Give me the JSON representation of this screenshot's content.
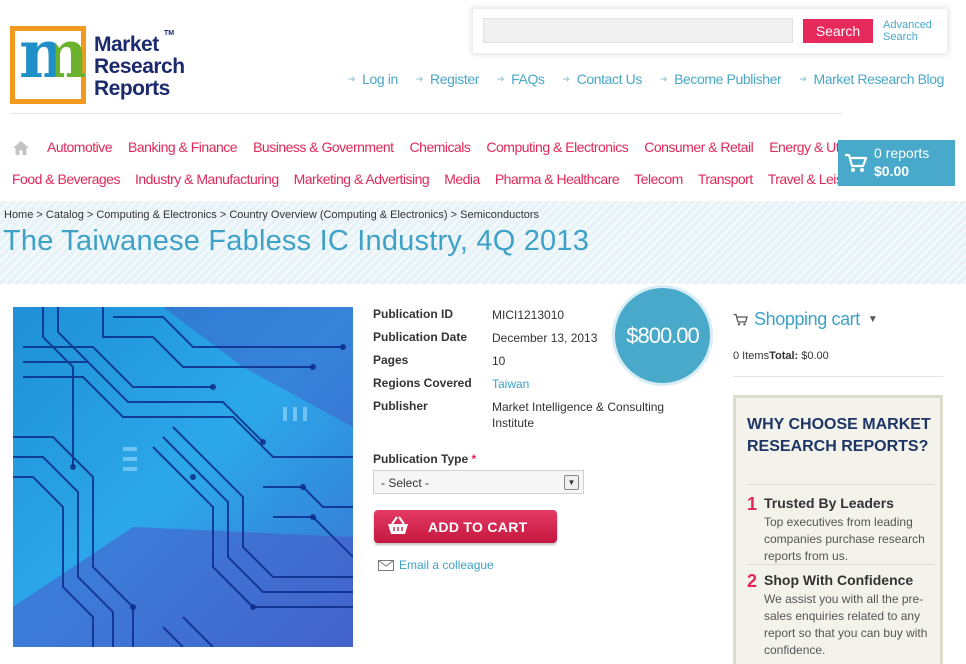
{
  "logo": {
    "letter_m": "m",
    "line1": "Market",
    "line2": "Research",
    "line3": "Reports",
    "tm": "TM"
  },
  "search": {
    "placeholder": "",
    "button_label": "Search",
    "advanced_line1": "Advanced",
    "advanced_line2": "Search"
  },
  "top_links": [
    "Log in",
    "Register",
    "FAQs",
    "Contact Us",
    "Become Publisher",
    "Market Research Blog"
  ],
  "nav": {
    "row1": [
      "Automotive",
      "Banking & Finance",
      "Business & Government",
      "Chemicals",
      "Computing & Electronics",
      "Consumer & Retail",
      "Energy & Utilities"
    ],
    "row2": [
      "Food & Beverages",
      "Industry & Manufacturing",
      "Marketing & Advertising",
      "Media",
      "Pharma & Healthcare",
      "Telecom",
      "Transport",
      "Travel & Leisure"
    ]
  },
  "cart": {
    "count": "0 reports",
    "total": "$0.00"
  },
  "breadcrumb": [
    "Home",
    "Catalog",
    "Computing & Electronics",
    "Country Overview (Computing & Electronics)",
    "Semiconductors"
  ],
  "breadcrumb_sep": " > ",
  "product": {
    "title": "The Taiwanese Fabless IC Industry, 4Q 2013",
    "price": "$800.00",
    "details": [
      {
        "label": "Publication ID",
        "value": "MICI1213010"
      },
      {
        "label": "Publication Date",
        "value": "December 13, 2013"
      },
      {
        "label": "Pages",
        "value": "10"
      },
      {
        "label": "Regions Covered",
        "value": "Taiwan"
      },
      {
        "label": "Publisher",
        "value": "Market Intelligence & Consulting Institute"
      }
    ],
    "publication_type_label": "Publication Type",
    "required_mark": "*",
    "select_value": "- Select -",
    "add_to_cart": "ADD TO CART",
    "email_colleague": "Email a colleague"
  },
  "sidebar": {
    "shopping_cart_title": "Shopping cart",
    "items_label": "0 Items",
    "total_label": "Total:",
    "total_value": "$0.00",
    "why_title": "WHY CHOOSE MARKET RESEARCH REPORTS?",
    "why_items": [
      {
        "num": "1",
        "title": "Trusted By Leaders",
        "text": "Top executives from leading companies purchase research reports from us."
      },
      {
        "num": "2",
        "title": "Shop With Confidence",
        "text": "We assist you with all the pre-sales enquiries related to any report so that you can buy with confidence."
      }
    ]
  },
  "colors": {
    "accent_blue": "#49a9cb",
    "accent_pink": "#e0285a",
    "navy": "#1e3566",
    "logo_orange": "#f39a1e"
  }
}
